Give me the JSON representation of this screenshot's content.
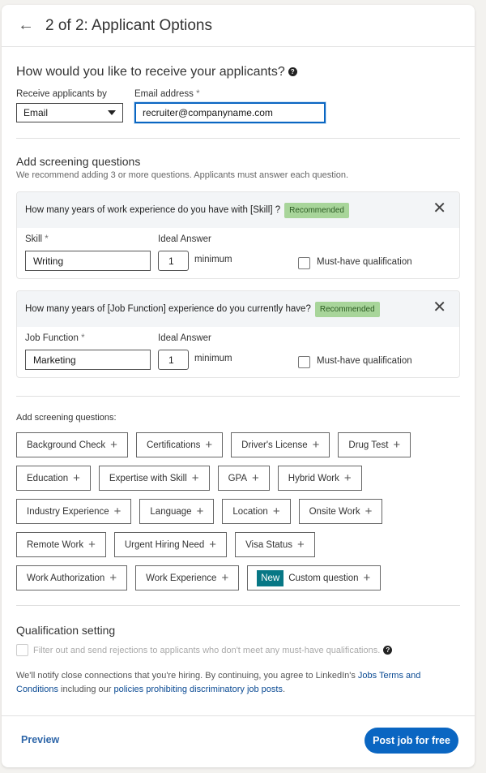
{
  "header": {
    "back_icon": "arrow-left-icon",
    "title": "2 of 2: Applicant Options"
  },
  "receive": {
    "question": "How would you like to receive your applicants?",
    "help_icon": "question-circle-icon",
    "method_label": "Receive applicants by",
    "method_value": "Email",
    "email_label": "Email address",
    "required_mark": "*",
    "email_value": "recruiter@companyname.com"
  },
  "screening": {
    "title": "Add screening questions",
    "subtitle": "We recommend adding 3 or more questions. Applicants must answer each question.",
    "questions": [
      {
        "text": "How many years of work experience do you have with [Skill] ?",
        "badge": "Recommended",
        "field_label": "Skill",
        "field_value": "Writing",
        "ideal_label": "Ideal Answer",
        "ideal_value": "1",
        "ideal_suffix": "minimum",
        "must_have_label": "Must-have qualification",
        "must_have_checked": false
      },
      {
        "text": "How many years of [Job Function] experience do you currently have?",
        "badge": "Recommended",
        "field_label": "Job Function",
        "field_value": "Marketing",
        "ideal_label": "Ideal Answer",
        "ideal_value": "1",
        "ideal_suffix": "minimum",
        "must_have_label": "Must-have qualification",
        "must_have_checked": false
      }
    ],
    "add_label": "Add screening questions:",
    "chips": [
      "Background Check",
      "Certifications",
      "Driver's License",
      "Drug Test",
      "Education",
      "Expertise with Skill",
      "GPA",
      "Hybrid Work",
      "Industry Experience",
      "Language",
      "Location",
      "Onsite Work",
      "Remote Work",
      "Urgent Hiring Need",
      "Visa Status",
      "Work Authorization",
      "Work Experience"
    ],
    "custom": {
      "badge": "New",
      "label": "Custom question"
    }
  },
  "qualification": {
    "title": "Qualification setting",
    "filter_label": "Filter out and send rejections to applicants who don't meet any must-have qualifications.",
    "filter_checked": false
  },
  "legal": {
    "text1": "We'll notify close connections that you're hiring. By continuing, you agree to LinkedIn's ",
    "link1": "Jobs Terms and Conditions",
    "text2": " including our ",
    "link2": "policies prohibiting discriminatory job posts",
    "text3": "."
  },
  "footer": {
    "preview": "Preview",
    "post": "Post job for free"
  },
  "colors": {
    "primary": "#0a66c2",
    "recommended_bg": "#a8d59a",
    "new_badge": "#077785"
  }
}
